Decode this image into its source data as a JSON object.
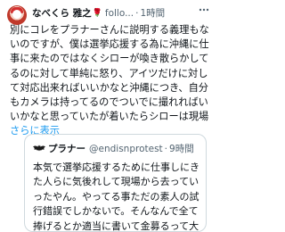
{
  "tweet": {
    "display_name": "なべくら 雅之",
    "handle": "follo...",
    "time": "1時間",
    "text": "別にコレをプラナーさんに説明する義理もないのですが、僕は選挙応援する為に沖縄に仕事に来たのではなくシローが喚き散らかしてるのに対して単純に怒り、アイツだけに対して対応出来ればいいかなと沖縄につき、自分もカメラは持ってるのでついでに撮れればいいかなと思っていたが着いたらシローは現場",
    "show_more": "さらに表示"
  },
  "quote": {
    "display_name": "プラナー",
    "handle": "@endisnprotest",
    "time": "9時間",
    "text": "本気で選挙応援するために仕事しにきた人らに気後れして現場から去っていったやん。やってる事ただの素人の試行錯誤でしかないで。そんなんで全て捧げるとか適当に書いて金募るって大"
  },
  "colors": {
    "link": "#1d9bf0",
    "secondary_text": "#536471",
    "border": "#cfd9de"
  },
  "icons": {
    "more": "more-horizontal-icon",
    "rose": "rose-icon",
    "quote_avatar": "bat-logo-icon"
  }
}
